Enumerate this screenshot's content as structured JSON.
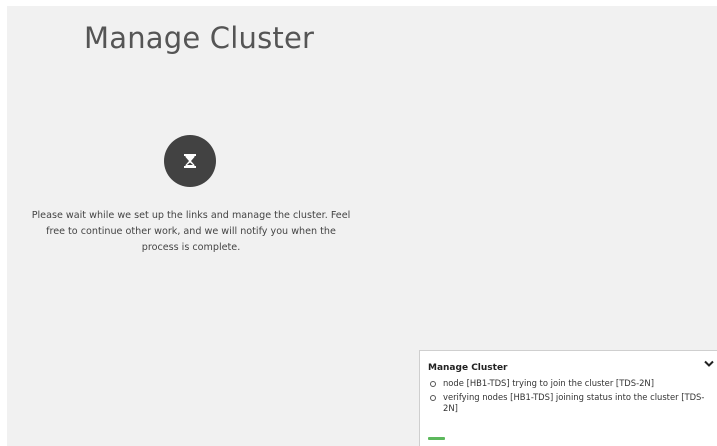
{
  "main": {
    "title": "Manage Cluster",
    "message": "Please wait while we set up the links and manage the cluster. Feel free to continue other work, and we will notify you when the process is complete.",
    "icon": "hourglass-icon"
  },
  "notification": {
    "title": "Manage Cluster",
    "collapse_icon": "chevron-down-icon",
    "items": [
      "node [HB1-TDS] trying to join the cluster [TDS-2N]",
      "verifying nodes [HB1-TDS] joining status into the cluster [TDS-2N]"
    ],
    "progress": 0.06,
    "progress_color": "#5cb85c"
  },
  "colors": {
    "background": "#f1f1f1",
    "icon_circle": "#424242"
  }
}
